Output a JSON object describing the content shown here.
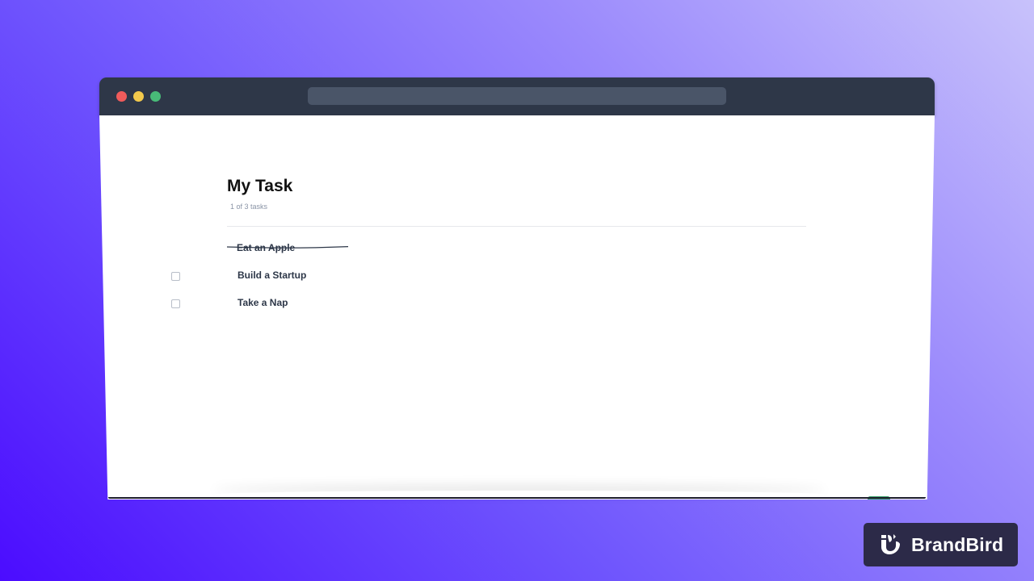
{
  "app": {
    "title": "My Task",
    "task_count_text": "1 of 3 tasks"
  },
  "tasks": [
    {
      "label": "Eat an Apple",
      "completed": true
    },
    {
      "label": "Build a Startup",
      "completed": false
    },
    {
      "label": "Take a Nap",
      "completed": false
    }
  ],
  "add_button": {
    "label": "+",
    "icon": "plus-icon"
  },
  "watermark": {
    "name": "BrandBird",
    "icon": "brandbird-logo-icon"
  },
  "colors": {
    "accent": "#38a169",
    "titlebar": "#2e3748",
    "text": "#2d3748",
    "muted": "#8a94a6"
  }
}
